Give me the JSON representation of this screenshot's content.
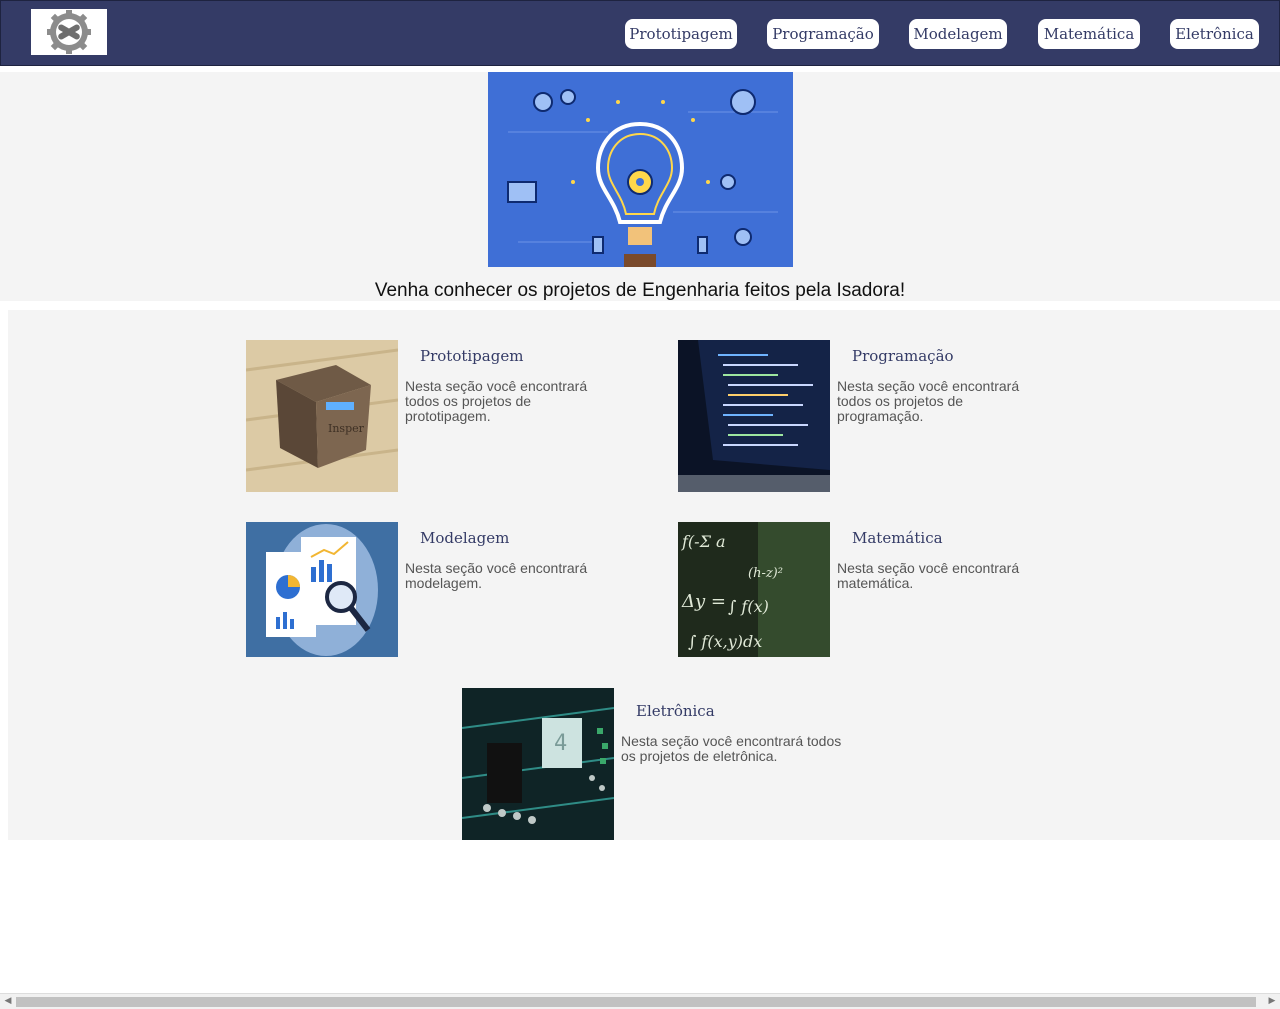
{
  "nav": {
    "items": [
      {
        "label": "Prototipagem"
      },
      {
        "label": "Programação"
      },
      {
        "label": "Modelagem"
      },
      {
        "label": "Matemática"
      },
      {
        "label": "Eletrônica"
      }
    ]
  },
  "hero": {
    "title": "Venha conhecer os projetos de Engenharia feitos pela Isadora!"
  },
  "cards": [
    {
      "title": "Prototipagem",
      "desc": "Nesta seção você encontrará todos os projetos de prototipagem."
    },
    {
      "title": "Programação",
      "desc": "Nesta seção você encontrará todos os projetos de programação."
    },
    {
      "title": "Modelagem",
      "desc": "Nesta seção você encontrará modelagem."
    },
    {
      "title": "Matemática",
      "desc": "Nesta seção você encontrará matemática."
    },
    {
      "title": "Eletrônica",
      "desc": "Nesta seção você encontrará todos os projetos de eletrônica."
    }
  ],
  "colors": {
    "navbar": "#343b66",
    "section_bg": "#f4f4f4",
    "hero_image_bg": "#3f6fd6"
  }
}
